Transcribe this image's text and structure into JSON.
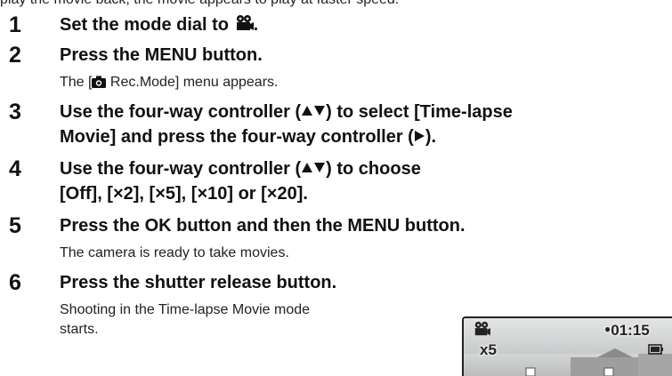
{
  "cut_line": "play the movie back, the movie appears to play at faster speed.",
  "steps": [
    {
      "num": "1",
      "head": "Set the mode dial to",
      "head_after": "."
    },
    {
      "num": "2",
      "head": "Press the MENU button.",
      "body_before": "The [",
      "body_after": " Rec.Mode] menu appears."
    },
    {
      "num": "3",
      "head_a": "Use the four-way controller (",
      "head_b": ") to select [Time-lapse",
      "head_line2_a": "Movie] and press the four-way controller (",
      "head_line2_b": ")."
    },
    {
      "num": "4",
      "head_a": "Use the four-way controller (",
      "head_b": ") to choose",
      "head_line2": "[Off], [×2], [×5], [×10] or [×20]."
    },
    {
      "num": "5",
      "head": "Press the OK button and then the MENU button.",
      "body": "The camera is ready to take movies."
    },
    {
      "num": "6",
      "head": "Press the shutter release button.",
      "body_line1": "Shooting in the Time-lapse Movie mode",
      "body_line2": "starts."
    }
  ],
  "preview": {
    "time": "01:15",
    "rate": "x5"
  },
  "icons": [
    "movie-mode-icon",
    "camera-icon",
    "triangle-up-icon",
    "triangle-down-icon",
    "triangle-right-icon",
    "battery-icon"
  ]
}
